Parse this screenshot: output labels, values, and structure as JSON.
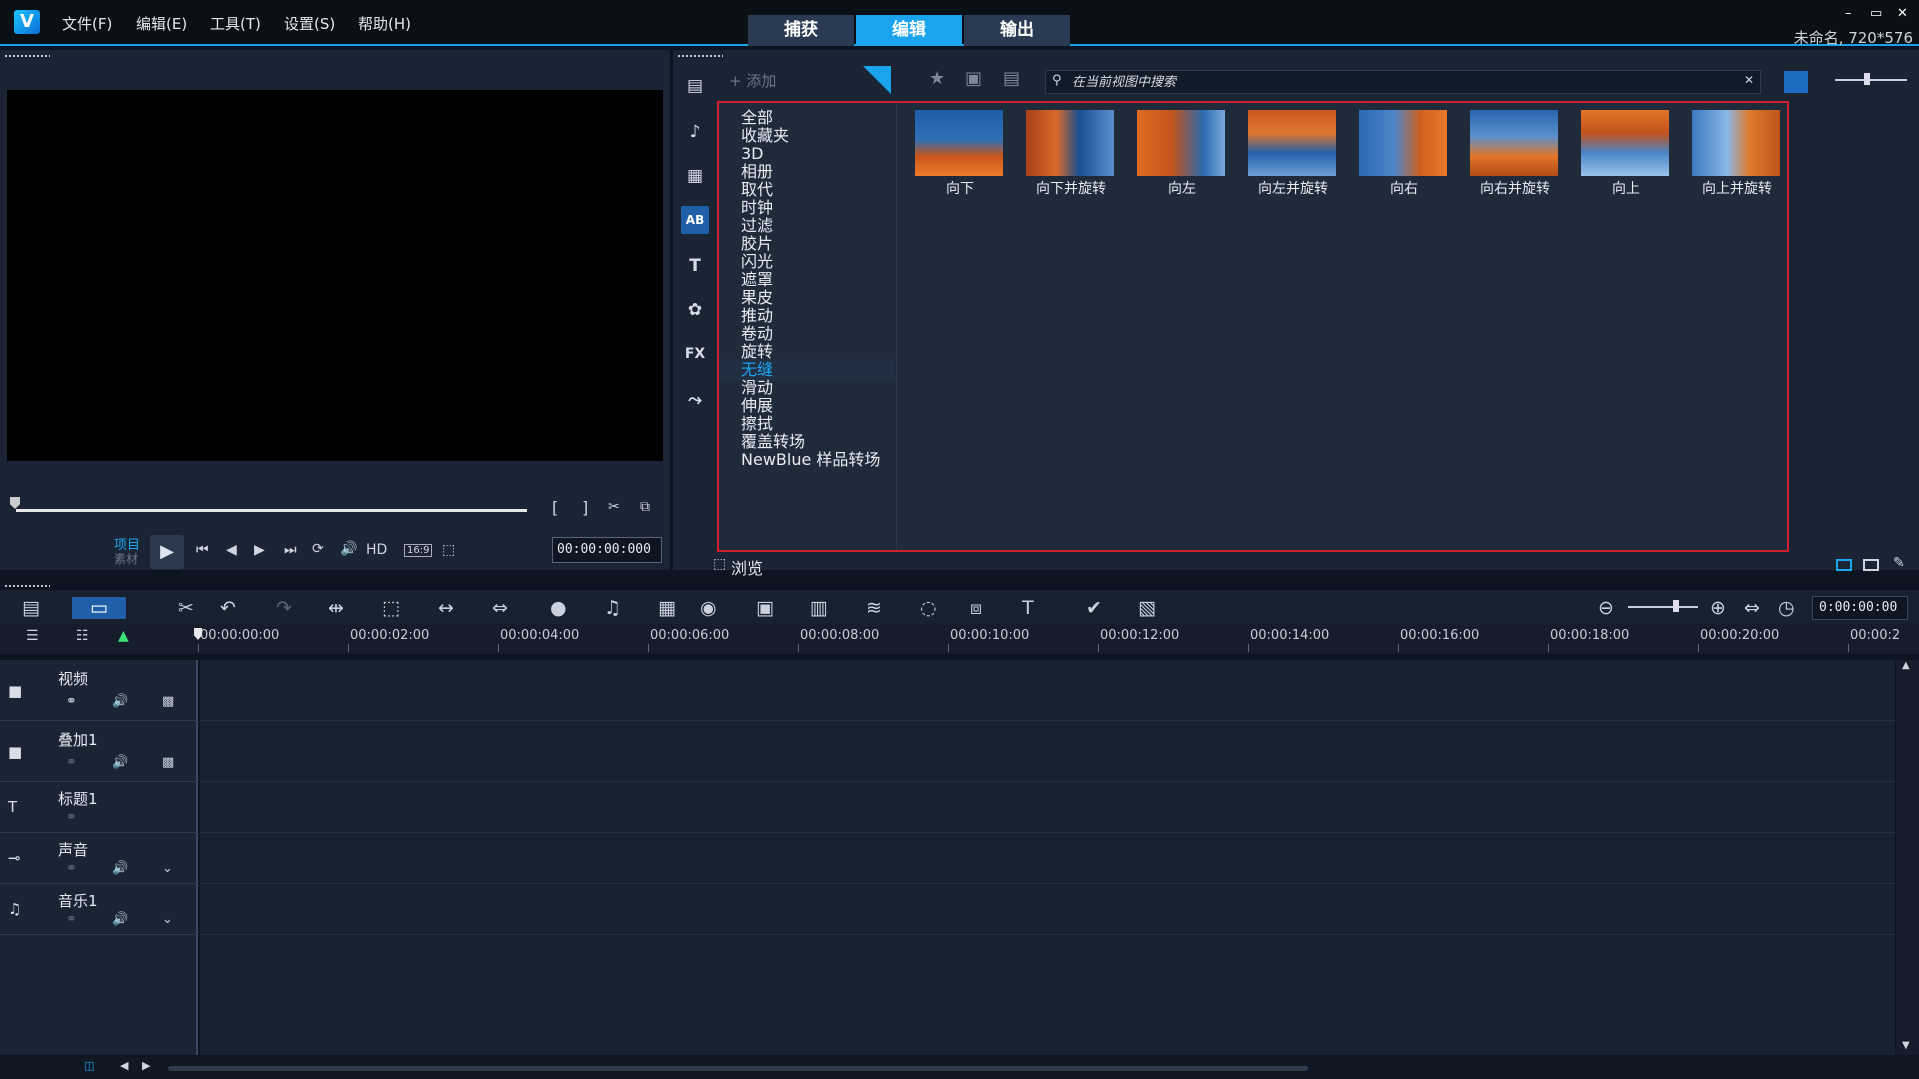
{
  "app": {
    "logo_letter": "V",
    "menus": [
      "文件(F)",
      "编辑(E)",
      "工具(T)",
      "设置(S)",
      "帮助(H)"
    ],
    "tabs": [
      "捕获",
      "编辑",
      "输出"
    ],
    "active_tab": "编辑",
    "project_info": "未命名, 720*576",
    "window_buttons": [
      "–",
      "▭",
      "✕"
    ]
  },
  "preview": {
    "mode_project": "项目",
    "mode_clip": "素材",
    "hd_label": "HD",
    "aspect_label": "16:9",
    "timecode": "00:00:00:000"
  },
  "library": {
    "add_label": "添加",
    "search_placeholder": "在当前视图中搜索",
    "browse_label": "浏览",
    "categories": [
      "全部",
      "收藏夹",
      "3D",
      "相册",
      "取代",
      "时钟",
      "过滤",
      "胶片",
      "闪光",
      "遮罩",
      "果皮",
      "推动",
      "卷动",
      "旋转",
      "无缝",
      "滑动",
      "伸展",
      "擦拭",
      "覆盖转场",
      "NewBlue 样品转场"
    ],
    "active_category": "无缝",
    "thumbnails": [
      "向下",
      "向下并旋转",
      "向左",
      "向左并旋转",
      "向右",
      "向右并旋转",
      "向上",
      "向上并旋转"
    ]
  },
  "timeline": {
    "current_time": "0:00:00:00",
    "ruler_ticks": [
      "00:00:00:00",
      "00:00:02:00",
      "00:00:04:00",
      "00:00:06:00",
      "00:00:08:00",
      "00:00:10:00",
      "00:00:12:00",
      "00:00:14:00",
      "00:00:16:00",
      "00:00:18:00",
      "00:00:20:00",
      "00:00:2"
    ],
    "tracks": [
      "视频",
      "叠加1",
      "标题1",
      "声音",
      "音乐1"
    ]
  },
  "colors": {
    "accent": "#1ba3ee",
    "highlight_border": "#d02030",
    "panel_bg": "#1b2434"
  }
}
